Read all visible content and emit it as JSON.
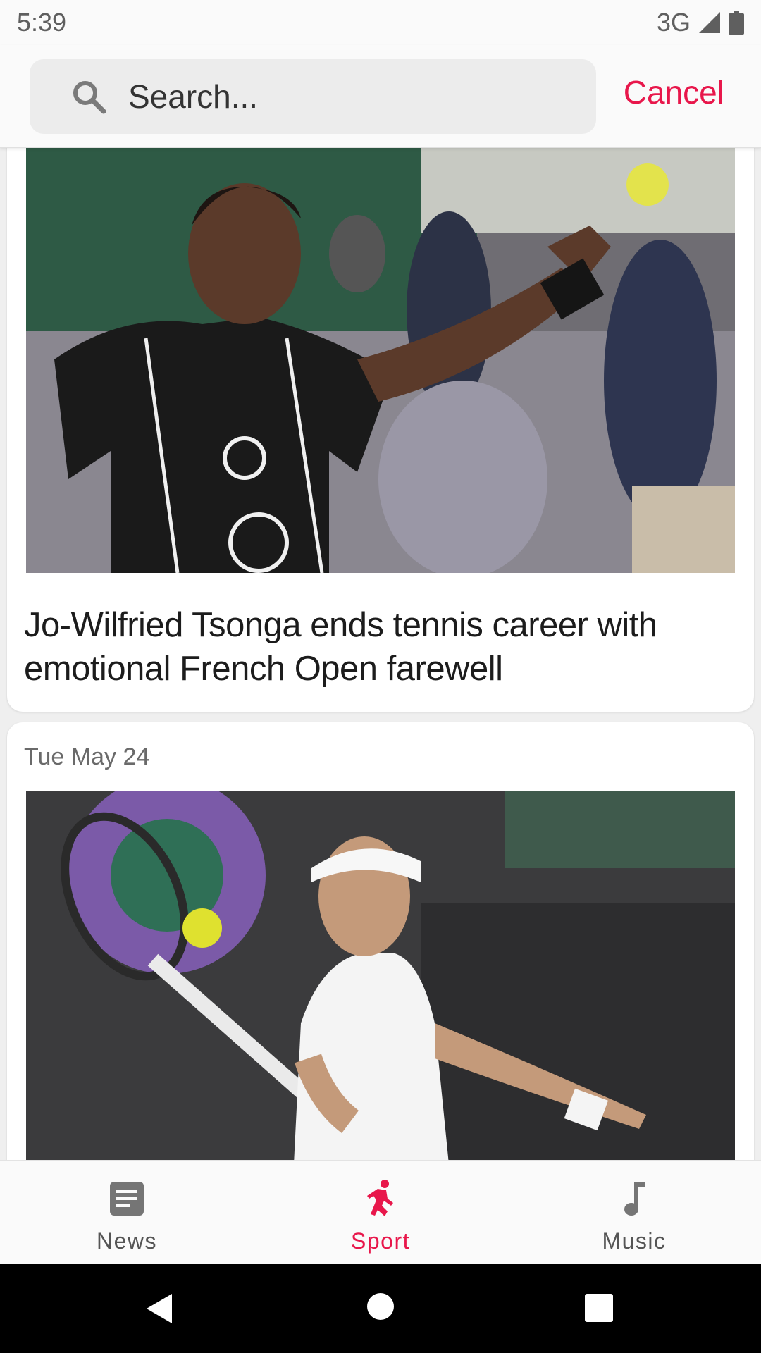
{
  "status_bar": {
    "time": "5:39",
    "network": "3G"
  },
  "search": {
    "placeholder": "Search...",
    "cancel_label": "Cancel"
  },
  "feed": {
    "articles": [
      {
        "headline": "Jo-Wilfried Tsonga ends tennis career with emotional French Open farewell"
      },
      {
        "date": "Tue May 24"
      }
    ]
  },
  "bottom_nav": {
    "items": [
      {
        "label": "News",
        "icon": "article-icon",
        "active": false
      },
      {
        "label": "Sport",
        "icon": "sport-icon",
        "active": true
      },
      {
        "label": "Music",
        "icon": "music-note-icon",
        "active": false
      }
    ]
  },
  "colors": {
    "accent": "#e8174b",
    "inactive": "#555555",
    "background": "#efefef"
  }
}
